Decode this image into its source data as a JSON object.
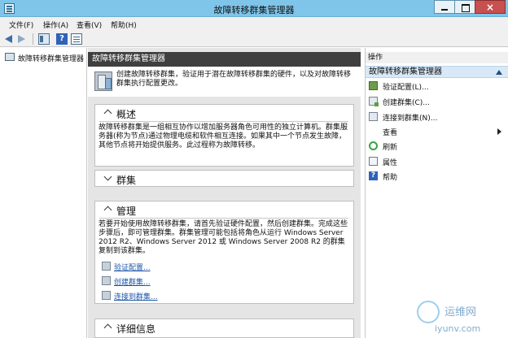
{
  "window": {
    "title": "故障转移群集管理器",
    "controls": {
      "minimize": "—",
      "maximize": "□",
      "close": "×"
    }
  },
  "menu": [
    "文件(F)",
    "操作(A)",
    "查看(V)",
    "帮助(H)"
  ],
  "toolbar": {
    "help_glyph": "?"
  },
  "tree": {
    "root_label": "故障转移群集管理器"
  },
  "center": {
    "header": "故障转移群集管理器",
    "intro": "创建故障转移群集，验证用于潜在故障转移群集的硬件，以及对故障转移群集执行配置更改。",
    "overview": {
      "title": "概述",
      "text": "故障转移群集是一组相互协作以增加服务器角色可用性的独立计算机。群集服务器(称为节点)通过物理电缆和软件相互连接。如果其中一个节点发生故障，其他节点将开始提供服务。此过程称为故障转移。"
    },
    "clusters": {
      "title": "群集"
    },
    "management": {
      "title": "管理",
      "text": "若要开始使用故障转移群集，请首先验证硬件配置，然后创建群集。完成这些步骤后，即可管理群集。群集管理可能包括将角色从运行 Windows Server 2012 R2、Windows Server 2012 或 Windows Server 2008 R2 的群集复制到该群集。",
      "links": [
        "验证配置...",
        "创建群集...",
        "连接到群集..."
      ]
    },
    "details": {
      "title": "详细信息"
    }
  },
  "actions": {
    "header": "操作",
    "section": "故障转移群集管理器",
    "items": [
      {
        "label": "验证配置(L)...",
        "icon": "validate-icon"
      },
      {
        "label": "创建群集(C)...",
        "icon": "create-cluster-icon"
      },
      {
        "label": "连接到群集(N)...",
        "icon": "connect-cluster-icon"
      },
      {
        "label": "查看",
        "icon": "submenu-arrow-icon"
      },
      {
        "label": "刷新",
        "icon": "refresh-icon"
      },
      {
        "label": "属性",
        "icon": "properties-icon"
      },
      {
        "label": "帮助",
        "icon": "help-icon"
      }
    ]
  },
  "watermark": {
    "name": "运维网",
    "url": "iyunv.com"
  },
  "colors": {
    "title_bar": "#7fc5ea",
    "header_dark": "#3f3f3f",
    "link": "#1c55a8",
    "action_section": "#d8e8f6"
  }
}
